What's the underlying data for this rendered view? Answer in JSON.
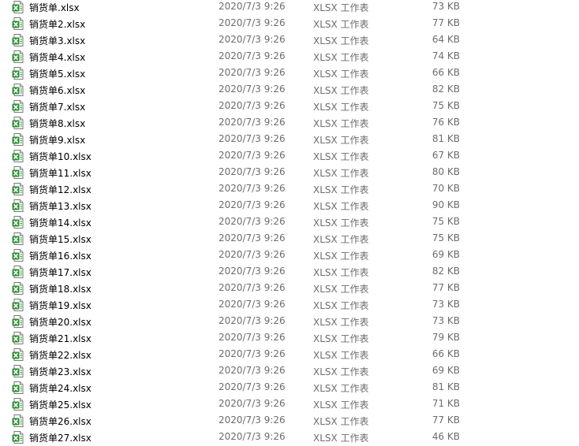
{
  "icon_name": "excel-file-icon",
  "colors": {
    "icon_green": "#2f8f37",
    "text_primary": "#000000",
    "text_secondary": "#6d6d6d"
  },
  "files": [
    {
      "name": "销货单.xlsx",
      "modified": "2020/7/3 9:26",
      "type": "XLSX 工作表",
      "size": "73 KB"
    },
    {
      "name": "销货单2.xlsx",
      "modified": "2020/7/3 9:26",
      "type": "XLSX 工作表",
      "size": "77 KB"
    },
    {
      "name": "销货单3.xlsx",
      "modified": "2020/7/3 9:26",
      "type": "XLSX 工作表",
      "size": "64 KB"
    },
    {
      "name": "销货单4.xlsx",
      "modified": "2020/7/3 9:26",
      "type": "XLSX 工作表",
      "size": "74 KB"
    },
    {
      "name": "销货单5.xlsx",
      "modified": "2020/7/3 9:26",
      "type": "XLSX 工作表",
      "size": "66 KB"
    },
    {
      "name": "销货单6.xlsx",
      "modified": "2020/7/3 9:26",
      "type": "XLSX 工作表",
      "size": "82 KB"
    },
    {
      "name": "销货单7.xlsx",
      "modified": "2020/7/3 9:26",
      "type": "XLSX 工作表",
      "size": "75 KB"
    },
    {
      "name": "销货单8.xlsx",
      "modified": "2020/7/3 9:26",
      "type": "XLSX 工作表",
      "size": "76 KB"
    },
    {
      "name": "销货单9.xlsx",
      "modified": "2020/7/3 9:26",
      "type": "XLSX 工作表",
      "size": "81 KB"
    },
    {
      "name": "销货单10.xlsx",
      "modified": "2020/7/3 9:26",
      "type": "XLSX 工作表",
      "size": "67 KB"
    },
    {
      "name": "销货单11.xlsx",
      "modified": "2020/7/3 9:26",
      "type": "XLSX 工作表",
      "size": "80 KB"
    },
    {
      "name": "销货单12.xlsx",
      "modified": "2020/7/3 9:26",
      "type": "XLSX 工作表",
      "size": "70 KB"
    },
    {
      "name": "销货单13.xlsx",
      "modified": "2020/7/3 9:26",
      "type": "XLSX 工作表",
      "size": "90 KB"
    },
    {
      "name": "销货单14.xlsx",
      "modified": "2020/7/3 9:26",
      "type": "XLSX 工作表",
      "size": "75 KB"
    },
    {
      "name": "销货单15.xlsx",
      "modified": "2020/7/3 9:26",
      "type": "XLSX 工作表",
      "size": "75 KB"
    },
    {
      "name": "销货单16.xlsx",
      "modified": "2020/7/3 9:26",
      "type": "XLSX 工作表",
      "size": "69 KB"
    },
    {
      "name": "销货单17.xlsx",
      "modified": "2020/7/3 9:26",
      "type": "XLSX 工作表",
      "size": "82 KB"
    },
    {
      "name": "销货单18.xlsx",
      "modified": "2020/7/3 9:26",
      "type": "XLSX 工作表",
      "size": "77 KB"
    },
    {
      "name": "销货单19.xlsx",
      "modified": "2020/7/3 9:26",
      "type": "XLSX 工作表",
      "size": "73 KB"
    },
    {
      "name": "销货单20.xlsx",
      "modified": "2020/7/3 9:26",
      "type": "XLSX 工作表",
      "size": "73 KB"
    },
    {
      "name": "销货单21.xlsx",
      "modified": "2020/7/3 9:26",
      "type": "XLSX 工作表",
      "size": "79 KB"
    },
    {
      "name": "销货单22.xlsx",
      "modified": "2020/7/3 9:26",
      "type": "XLSX 工作表",
      "size": "66 KB"
    },
    {
      "name": "销货单23.xlsx",
      "modified": "2020/7/3 9:26",
      "type": "XLSX 工作表",
      "size": "69 KB"
    },
    {
      "name": "销货单24.xlsx",
      "modified": "2020/7/3 9:26",
      "type": "XLSX 工作表",
      "size": "81 KB"
    },
    {
      "name": "销货单25.xlsx",
      "modified": "2020/7/3 9:26",
      "type": "XLSX 工作表",
      "size": "71 KB"
    },
    {
      "name": "销货单26.xlsx",
      "modified": "2020/7/3 9:26",
      "type": "XLSX 工作表",
      "size": "77 KB"
    },
    {
      "name": "销货单27.xlsx",
      "modified": "2020/7/3 9:26",
      "type": "XLSX 工作表",
      "size": "46 KB"
    }
  ]
}
